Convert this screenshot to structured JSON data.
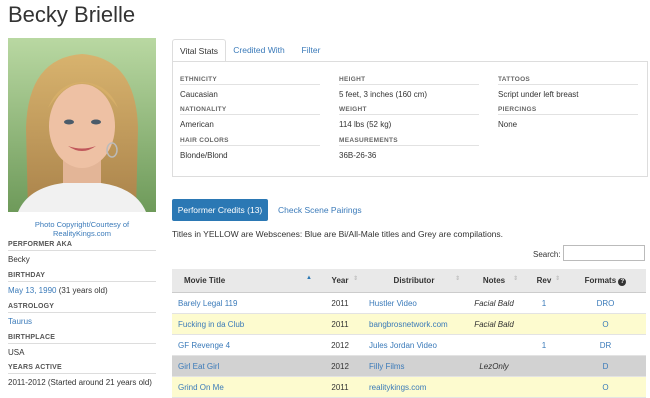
{
  "page_title": "Becky Brielle",
  "photo_caption": "Photo Copyright/Courtesy of RealityKings.com",
  "sidebar": [
    {
      "heading": "PERFORMER AKA",
      "value": "Becky"
    },
    {
      "heading": "BIRTHDAY",
      "link": "May 13, 1990",
      "value": "(31 years old)"
    },
    {
      "heading": "ASTROLOGY",
      "link": "Taurus",
      "value": ""
    },
    {
      "heading": "BIRTHPLACE",
      "value": "USA"
    },
    {
      "heading": "YEARS ACTIVE",
      "value": "2011-2012 (Started around 21 years old)"
    }
  ],
  "tabs": [
    "Vital Stats",
    "Credited With",
    "Filter"
  ],
  "stats": {
    "ethnicity": {
      "label": "ETHNICITY",
      "value": "Caucasian"
    },
    "nationality": {
      "label": "NATIONALITY",
      "value": "American"
    },
    "hair": {
      "label": "HAIR COLORS",
      "value": "Blonde/Blond"
    },
    "height": {
      "label": "HEIGHT",
      "value": "5 feet, 3 inches (160 cm)"
    },
    "weight": {
      "label": "WEIGHT",
      "value": "114 lbs (52 kg)"
    },
    "measurements": {
      "label": "MEASUREMENTS",
      "value": "36B-26-36"
    },
    "tattoos": {
      "label": "TATTOOS",
      "value": "Script under left breast"
    },
    "piercings": {
      "label": "PIERCINGS",
      "value": "None"
    }
  },
  "credits_button": "Performer Credits (13)",
  "pairings_link": "Check Scene Pairings",
  "legend_note": "Titles in YELLOW are Webscenes: Blue are Bi/All-Male titles and Grey are compilations.",
  "search_label": "Search:",
  "table": {
    "headers": [
      "Movie Title",
      "Year",
      "Distributor",
      "Notes",
      "Rev",
      "Formats"
    ],
    "rows": [
      {
        "title": "Barely Legal 119",
        "year": "2011",
        "distributor": "Hustler Video",
        "notes": "Facial Bald",
        "rev": "1",
        "formats": "DRO",
        "style": "white"
      },
      {
        "title": "Fucking in da Club",
        "year": "2011",
        "distributor": "bangbrosnetwork.com",
        "notes": "Facial Bald",
        "rev": "",
        "formats": "O",
        "style": "yellow"
      },
      {
        "title": "GF Revenge 4",
        "year": "2012",
        "distributor": "Jules Jordan Video",
        "notes": "",
        "rev": "1",
        "formats": "DR",
        "style": "white"
      },
      {
        "title": "Girl Eat Girl",
        "year": "2012",
        "distributor": "Filly Films",
        "notes": "LezOnly",
        "rev": "",
        "formats": "D",
        "style": "grey"
      },
      {
        "title": "Grind On Me",
        "year": "2011",
        "distributor": "realitykings.com",
        "notes": "",
        "rev": "",
        "formats": "O",
        "style": "yellow"
      }
    ]
  }
}
